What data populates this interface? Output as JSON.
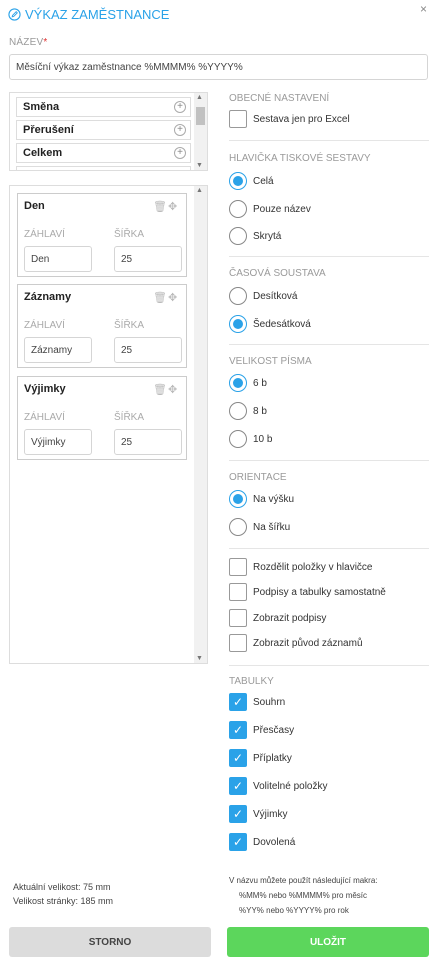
{
  "header": {
    "title": "VÝKAZ ZAMĚSTNANCE",
    "close": "×"
  },
  "name": {
    "label": "NÁZEV",
    "required": "*",
    "value": "Měsíční výkaz zaměstnance %MMMM% %YYYY%"
  },
  "available_items": [
    {
      "label": "Směna"
    },
    {
      "label": "Přerušení"
    },
    {
      "label": "Celkem"
    }
  ],
  "columns": [
    {
      "title": "Den",
      "header_label": "ZÁHLAVÍ",
      "width_label": "ŠÍŘKA",
      "header_value": "Den",
      "width_value": "25"
    },
    {
      "title": "Záznamy",
      "header_label": "ZÁHLAVÍ",
      "width_label": "ŠÍŘKA",
      "header_value": "Záznamy",
      "width_value": "25"
    },
    {
      "title": "Výjimky",
      "header_label": "ZÁHLAVÍ",
      "width_label": "ŠÍŘKA",
      "header_value": "Výjimky",
      "width_value": "25"
    }
  ],
  "general": {
    "heading": "OBECNÉ NASTAVENÍ",
    "excel_only": "Sestava jen pro Excel",
    "excel_checked": false
  },
  "print_header": {
    "heading": "HLAVIČKA TISKOVÉ SESTAVY",
    "options": [
      "Celá",
      "Pouze název",
      "Skrytá"
    ],
    "selected": 0
  },
  "time_system": {
    "heading": "ČASOVÁ SOUSTAVA",
    "options": [
      "Desítková",
      "Šedesátková"
    ],
    "selected": 1
  },
  "font_size": {
    "heading": "VELIKOST PÍSMA",
    "options": [
      "6 b",
      "8 b",
      "10 b"
    ],
    "selected": 0
  },
  "orientation": {
    "heading": "ORIENTACE",
    "options": [
      "Na výšku",
      "Na šířku"
    ],
    "selected": 0
  },
  "misc": [
    {
      "label": "Rozdělit položky v hlavičce",
      "checked": false
    },
    {
      "label": "Podpisy a tabulky samostatně",
      "checked": false
    },
    {
      "label": "Zobrazit podpisy",
      "checked": false
    },
    {
      "label": "Zobrazit původ záznamů",
      "checked": false
    }
  ],
  "tables": {
    "heading": "TABULKY",
    "items": [
      {
        "label": "Souhrn",
        "checked": true
      },
      {
        "label": "Přesčasy",
        "checked": true
      },
      {
        "label": "Příplatky",
        "checked": true
      },
      {
        "label": "Volitelné položky",
        "checked": true
      },
      {
        "label": "Výjimky",
        "checked": true
      },
      {
        "label": "Dovolená",
        "checked": true
      }
    ]
  },
  "sizes": {
    "current": "Aktuální velikost: 75 mm",
    "page": "Velikost stránky: 185 mm"
  },
  "macros": {
    "intro": "V názvu můžete použít následující makra:",
    "month": "%MM% nebo %MMMM% pro měsíc",
    "year": "%YY% nebo %YYYY% pro rok"
  },
  "buttons": {
    "cancel": "STORNO",
    "save": "ULOŽIT"
  },
  "colors": {
    "accent": "#2aa2e8",
    "save": "#5cd65c",
    "cancel": "#dcdcdc"
  }
}
